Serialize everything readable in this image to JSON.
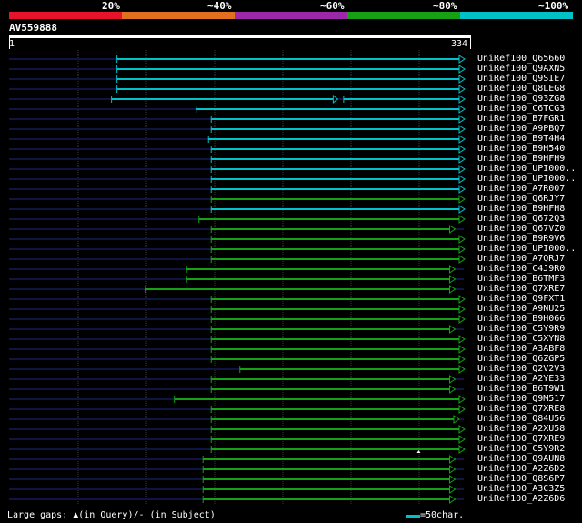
{
  "header": {
    "percent_labels": [
      "20%",
      "~40%",
      "~60%",
      "~80%",
      "~100%"
    ],
    "identity_colors": [
      "#e8122a",
      "#e07020",
      "#9c27a8",
      "#16a016",
      "#00c0c8"
    ],
    "query_name": "AV559888",
    "ruler_start": "1",
    "ruler_end": "334"
  },
  "colors": {
    "cyan": "#00c0c8",
    "green": "#16a016",
    "navy": "#101440",
    "gridline": "#3a3a3a",
    "text": "#ffffff"
  },
  "query_length": 334,
  "hits": [
    {
      "label": "UniRef100_Q65660",
      "color": "cyan",
      "start": 80,
      "end": 334,
      "ftype": "triangle"
    },
    {
      "label": "UniRef100_Q9AXN5",
      "color": "cyan",
      "start": 80,
      "end": 334,
      "ftype": "triangle"
    },
    {
      "label": "UniRef100_Q9SIE7",
      "color": "cyan",
      "start": 80,
      "end": 334,
      "ftype": "triangle"
    },
    {
      "label": "UniRef100_Q8LEG8",
      "color": "cyan",
      "start": 80,
      "end": 334,
      "ftype": "triangle"
    },
    {
      "label": "UniRef100_Q93ZG8",
      "color": "cyan",
      "start": 76,
      "end": 334,
      "ftype": "triangle",
      "gap": {
        "start": 241,
        "end": 246
      }
    },
    {
      "label": "UniRef100_C6TCG3",
      "color": "cyan",
      "start": 138,
      "end": 334,
      "ftype": "triangle"
    },
    {
      "label": "UniRef100_B7FGR1",
      "color": "cyan",
      "start": 149,
      "end": 334,
      "ftype": "triangle"
    },
    {
      "label": "UniRef100_A9PBQ7",
      "color": "cyan",
      "start": 149,
      "end": 334,
      "ftype": "triangle"
    },
    {
      "label": "UniRef100_B9T4H4",
      "color": "cyan",
      "start": 147,
      "end": 334,
      "ftype": "triangle"
    },
    {
      "label": "UniRef100_B9H540",
      "color": "cyan",
      "start": 149,
      "end": 334,
      "ftype": "triangle"
    },
    {
      "label": "UniRef100_B9HFH9",
      "color": "cyan",
      "start": 149,
      "end": 334,
      "ftype": "triangle"
    },
    {
      "label": "UniRef100_UPI000..",
      "color": "cyan",
      "start": 149,
      "end": 334,
      "ftype": "triangle"
    },
    {
      "label": "UniRef100_UPI000..",
      "color": "cyan",
      "start": 149,
      "end": 334,
      "ftype": "triangle"
    },
    {
      "label": "UniRef100_A7R007",
      "color": "cyan",
      "start": 149,
      "end": 334,
      "ftype": "triangle"
    },
    {
      "label": "UniRef100_Q6RJY7",
      "color": "green",
      "start": 149,
      "end": 334,
      "ftype": "triangle"
    },
    {
      "label": "UniRef100_B9HFH8",
      "color": "cyan",
      "start": 149,
      "end": 334,
      "ftype": "triangle"
    },
    {
      "label": "UniRef100_Q672Q3",
      "color": "green",
      "start": 140,
      "end": 334,
      "ftype": "triangle"
    },
    {
      "label": "UniRef100_Q67VZ0",
      "color": "green",
      "start": 149,
      "end": 327,
      "ftype": "arrow"
    },
    {
      "label": "UniRef100_B9R9V6",
      "color": "green",
      "start": 149,
      "end": 334,
      "ftype": "triangle"
    },
    {
      "label": "UniRef100_UPI000..",
      "color": "green",
      "start": 149,
      "end": 334,
      "ftype": "triangle"
    },
    {
      "label": "UniRef100_A7QRJ7",
      "color": "green",
      "start": 149,
      "end": 334,
      "ftype": "triangle"
    },
    {
      "label": "UniRef100_C4J9R0",
      "color": "green",
      "start": 131,
      "end": 327,
      "ftype": "arrow"
    },
    {
      "label": "UniRef100_B6TMF3",
      "color": "green",
      "start": 131,
      "end": 327,
      "ftype": "arrow"
    },
    {
      "label": "UniRef100_Q7XRE7",
      "color": "green",
      "start": 101,
      "end": 327,
      "ftype": "arrow"
    },
    {
      "label": "UniRef100_Q9FXT1",
      "color": "green",
      "start": 149,
      "end": 334,
      "ftype": "triangle"
    },
    {
      "label": "UniRef100_A9NU25",
      "color": "green",
      "start": 149,
      "end": 334,
      "ftype": "triangle"
    },
    {
      "label": "UniRef100_B9H066",
      "color": "green",
      "start": 149,
      "end": 334,
      "ftype": "triangle"
    },
    {
      "label": "UniRef100_C5Y9R9",
      "color": "green",
      "start": 149,
      "end": 327,
      "ftype": "arrow"
    },
    {
      "label": "UniRef100_C5XYN8",
      "color": "green",
      "start": 149,
      "end": 334,
      "ftype": "triangle"
    },
    {
      "label": "UniRef100_A3ABF8",
      "color": "green",
      "start": 149,
      "end": 334,
      "ftype": "triangle"
    },
    {
      "label": "UniRef100_Q6ZGP5",
      "color": "green",
      "start": 149,
      "end": 334,
      "ftype": "triangle"
    },
    {
      "label": "UniRef100_Q2V2V3",
      "color": "green",
      "start": 170,
      "end": 334,
      "ftype": "triangle"
    },
    {
      "label": "UniRef100_A2YE33",
      "color": "green",
      "start": 149,
      "end": 327,
      "ftype": "arrow"
    },
    {
      "label": "UniRef100_B6T9W1",
      "color": "green",
      "start": 149,
      "end": 327,
      "ftype": "arrow"
    },
    {
      "label": "UniRef100_Q9M517",
      "color": "green",
      "start": 122,
      "end": 334,
      "ftype": "triangle"
    },
    {
      "label": "UniRef100_Q7XRE8",
      "color": "green",
      "start": 149,
      "end": 334,
      "ftype": "triangle"
    },
    {
      "label": "UniRef100_Q84U56",
      "color": "green",
      "start": 149,
      "end": 330,
      "ftype": "arrow"
    },
    {
      "label": "UniRef100_A2XU58",
      "color": "green",
      "start": 149,
      "end": 334,
      "ftype": "triangle"
    },
    {
      "label": "UniRef100_Q7XRE9",
      "color": "green",
      "start": 149,
      "end": 334,
      "ftype": "triangle"
    },
    {
      "label": "UniRef100_C5Y9R2",
      "color": "green",
      "start": 149,
      "end": 334,
      "ftype": "triangle",
      "marker": 301
    },
    {
      "label": "UniRef100_Q9AUN8",
      "color": "green",
      "start": 143,
      "end": 327,
      "ftype": "arrow"
    },
    {
      "label": "UniRef100_A2Z6D2",
      "color": "green",
      "start": 143,
      "end": 327,
      "ftype": "arrow"
    },
    {
      "label": "UniRef100_Q8S6P7",
      "color": "green",
      "start": 143,
      "end": 327,
      "ftype": "arrow"
    },
    {
      "label": "UniRef100_A3C3Z5",
      "color": "green",
      "start": 143,
      "end": 327,
      "ftype": "arrow"
    },
    {
      "label": "UniRef100_A2Z6D6",
      "color": "green",
      "start": 143,
      "end": 327,
      "ftype": "arrow"
    }
  ],
  "footer": {
    "legend_text": "Large gaps: ▲(in Query)/- (in Subject)",
    "scale_text": "=50char."
  }
}
